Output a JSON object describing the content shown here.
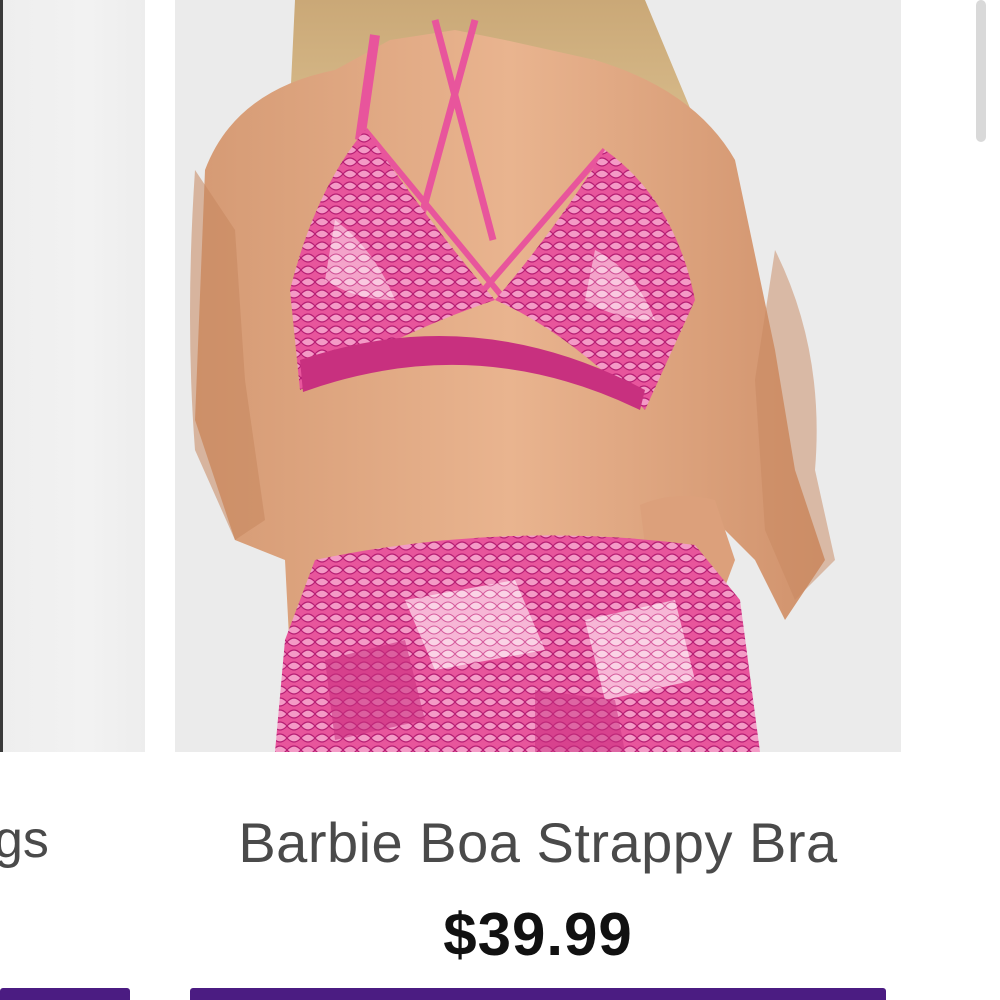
{
  "carousel": {
    "previous_product": {
      "title_fragment": "gs"
    },
    "product": {
      "title": "Barbie Boa Strappy Bra",
      "price": "$39.99",
      "image_alt": "Model wearing pink snakeskin print strappy bra and matching leggings"
    }
  },
  "colors": {
    "button": "#4b1c82",
    "price_text": "#111111",
    "title_text": "#4a4a4a",
    "print_pink": "#e8559c",
    "print_magenta": "#b51d73",
    "print_light": "#f7b6d6"
  }
}
